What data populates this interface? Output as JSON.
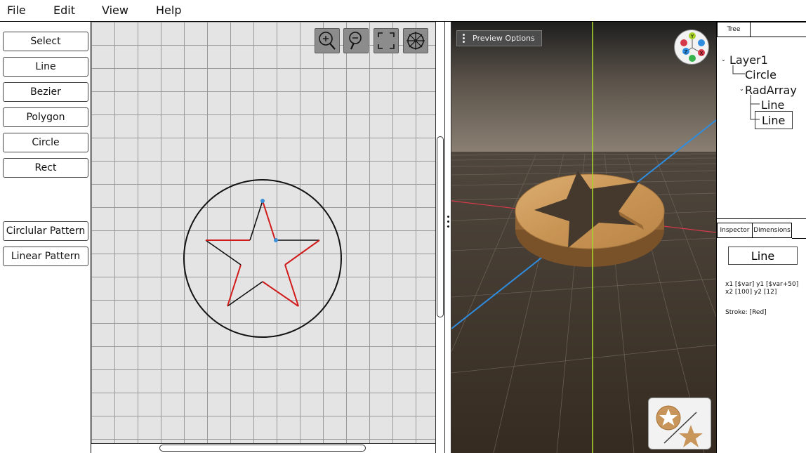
{
  "menu": [
    "File",
    "Edit",
    "View",
    "Help"
  ],
  "tools": {
    "primary": [
      "Select",
      "Line",
      "Bezier",
      "Polygon",
      "Circle",
      "Rect"
    ],
    "patterns": [
      "Circlular Pattern",
      "Linear Pattern"
    ]
  },
  "canvas_toolbar": [
    "zoom-in-icon",
    "zoom-out-icon",
    "fit-view-icon",
    "reset-view-icon"
  ],
  "viewport": {
    "preview_options_label": "Preview Options",
    "gizmo_axes": [
      "X",
      "Y",
      "Z"
    ],
    "colors": {
      "wood": "#c8955a",
      "x_axis": "#d6394a",
      "y_axis": "#a9d12a",
      "z_axis": "#2e8de0"
    }
  },
  "right_panel": {
    "tree_tabs": [
      "Tree",
      ""
    ],
    "tree": [
      "Layer1",
      "Circle",
      "RadArray",
      "Line",
      "Line"
    ],
    "selected_tree_item": "Line",
    "inspector_tabs": [
      "Inspector",
      "Dimensions"
    ],
    "inspector": {
      "title": "Line",
      "coords_line1": "x1 [$var] y1 [$var+50]",
      "coords_line2": "x2 [100]  y2 [12]",
      "stroke": "Stroke: [Red]"
    }
  },
  "drawing": {
    "stroke_color": "#d11a1a",
    "outline_color": "#111111"
  }
}
